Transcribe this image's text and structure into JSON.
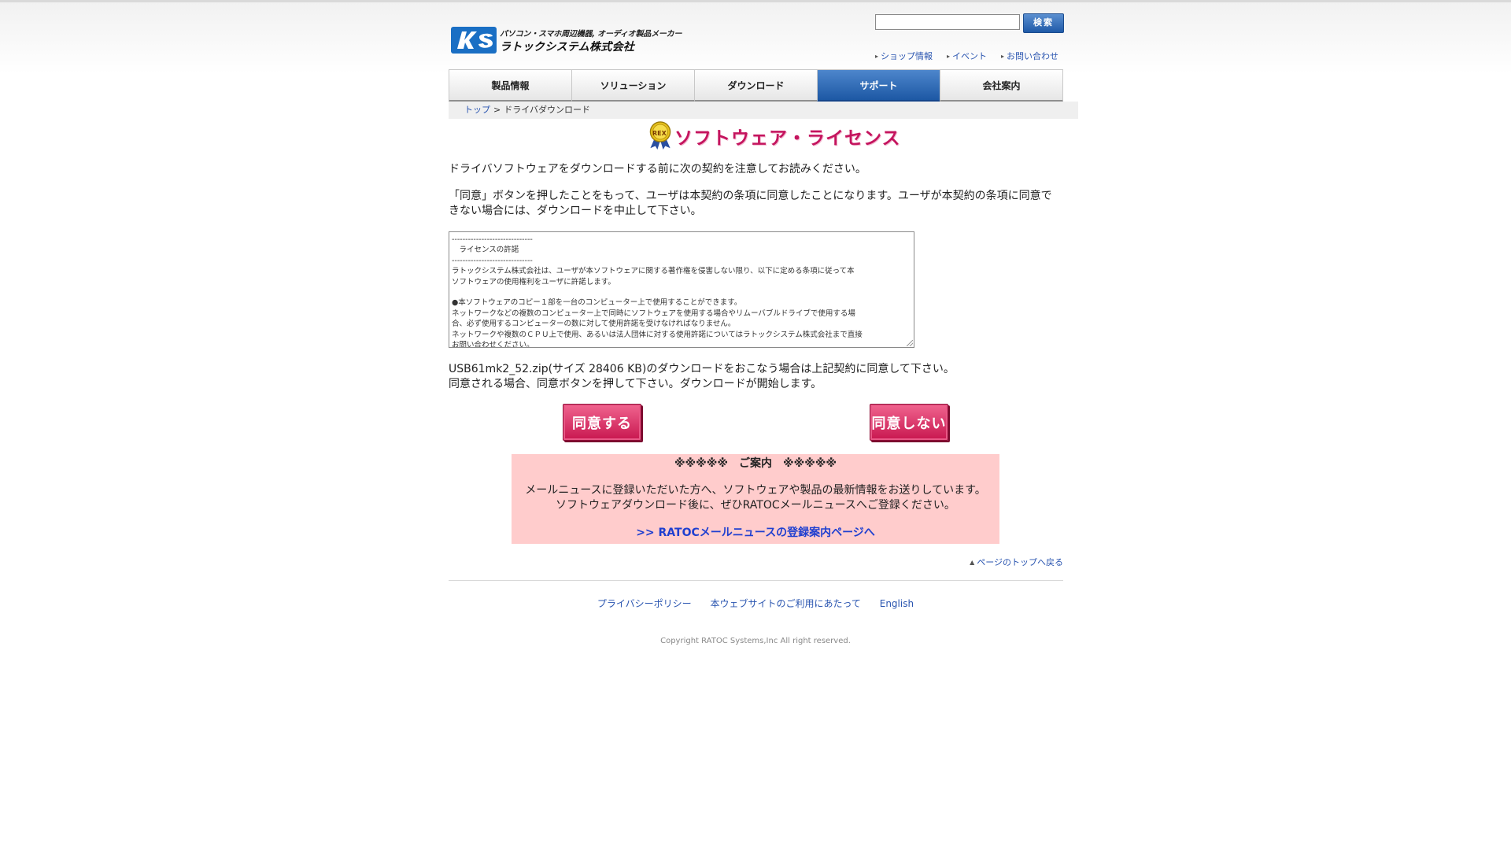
{
  "header": {
    "logo_tagline": "パソコン・スマホ周辺機器, オーディオ製品メーカー",
    "logo_name": "ラトックシステム株式会社",
    "search": {
      "value": "",
      "button_label": "検索"
    },
    "utility_links": [
      "ショップ情報",
      "イベント",
      "お問い合わせ"
    ]
  },
  "nav": {
    "items": [
      "製品情報",
      "ソリューション",
      "ダウンロード",
      "サポート",
      "会社案内"
    ],
    "active": "サポート"
  },
  "breadcrumb": {
    "home": "トップ",
    "separator": ">",
    "current": "ドライバダウンロード"
  },
  "license": {
    "badge": "REX",
    "title": "ソフトウェア・ライセンス",
    "intro1": "ドライバソフトウェアをダウンロードする前に次の契約を注意してお読みください。",
    "intro2": "「同意」ボタンを押したことをもって、ユーザは本契約の条項に同意したことになります。ユーザが本契約の条項に同意できない場合には、ダウンロードを中止して下さい。",
    "text_lines": [
      "------------------------------",
      "　ライセンスの許諾",
      "------------------------------",
      "ラトックシステム株式会社は、ユーザが本ソフトウェアに関する著作権を侵害しない限り、以下に定める条項に従って本",
      "ソフトウェアの使用権利をユーザに許諾します。",
      "",
      "●本ソフトウェアのコピー１部を一台のコンピューター上で使用することができます。",
      "ネットワークなどの複数のコンピューター上で同時にソフトウェアを使用する場合やリムーバブルドライブで使用する場",
      "合、必ず使用するコンピューターの数に対して使用許諾を受けなければなりません。",
      "ネットワークや複数のＣＰＵ上で使用、あるいは法人団体に対する使用許諾についてはラトックシステム株式会社まで直接",
      "お問い合わせください。"
    ],
    "download_line1": "USB61mk2_52.zip(サイズ 28406 KB)のダウンロードをおこなう場合は上記契約に同意して下さい。",
    "download_line2": "同意される場合、同意ボタンを押して下さい。ダウンロードが開始します。",
    "agree_label": "同意する",
    "disagree_label": "同意しない"
  },
  "notice": {
    "heading": "※※※※※　ご案内　※※※※※",
    "body1": "メールニュースに登録いただいた方へ、ソフトウェアや製品の最新情報をお送りしています。",
    "body2": "ソフトウェアダウンロード後に、ぜひRATOCメールニュースへご登録ください。",
    "link": ">> RATOCメールニュースの登録案内ページへ"
  },
  "to_top": "ページのトップへ戻る",
  "footer": {
    "links": [
      "プライバシーポリシー",
      "本ウェブサイトのご利用にあたって",
      "English"
    ],
    "copyright": "Copyright RATOC Systems,Inc All right reserved."
  },
  "colors": {
    "link": "#2a55b0",
    "nav_active": "#1d58a4",
    "title_pink": "#c4145e",
    "button_pink": "#c8174f",
    "notice_bg": "#ffcccc",
    "notice_link": "#1f3fd0"
  },
  "icons": [
    "ratoc-logo",
    "rex-ribbon-badge",
    "arrow-right-icon",
    "arrow-up-icon",
    "resize-grip-icon"
  ]
}
